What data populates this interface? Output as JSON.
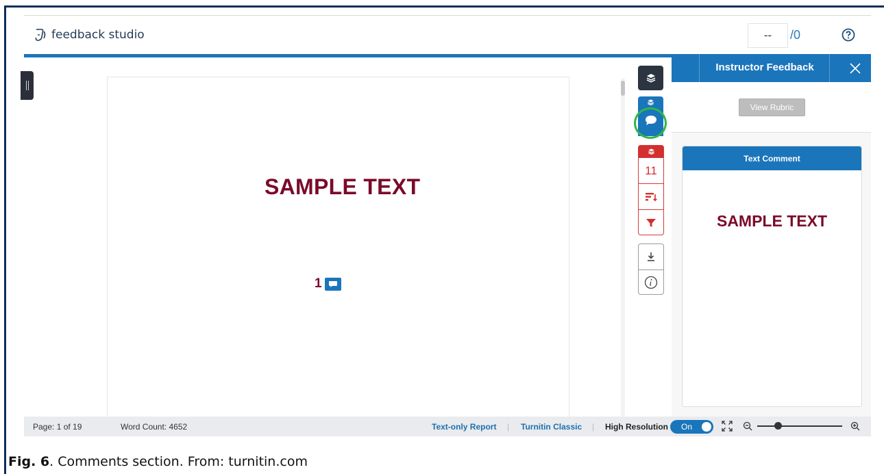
{
  "app": {
    "name": "feedback studio"
  },
  "score": {
    "value": "--",
    "total": "/0"
  },
  "document": {
    "sample_text": "SAMPLE TEXT",
    "comment_marker_number": "1"
  },
  "toolbar": {
    "similarity_count": "11"
  },
  "panel": {
    "title": "Instructor Feedback",
    "view_rubric_label": "View Rubric",
    "comment_card_title": "Text Comment",
    "comment_text": "SAMPLE TEXT"
  },
  "statusbar": {
    "page": "Page: 1 of 19",
    "word_count": "Word Count: 4652",
    "text_only_report": "Text-only Report",
    "separator": "|",
    "turnitin_classic": "Turnitin Classic",
    "high_resolution": "High Resolution",
    "toggle_state": "On"
  },
  "caption": {
    "label": "Fig. 6",
    "text": ". Comments section. From: turnitin.com"
  },
  "colors": {
    "brand_blue": "#1b75bb",
    "dark_navy": "#2b3440",
    "red": "#d32f2f",
    "sample_text": "#7b0a2a",
    "highlight_green": "#2fb84a"
  }
}
